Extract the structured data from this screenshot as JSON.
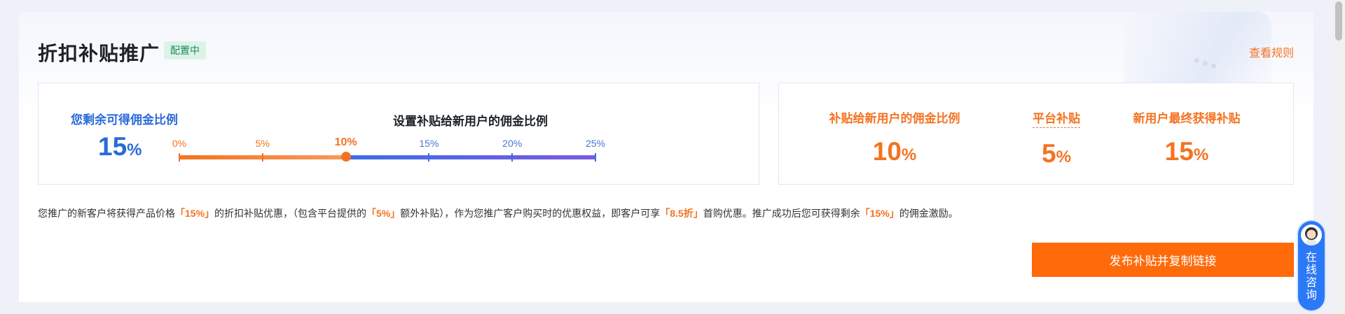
{
  "header": {
    "title": "折扣补贴推广",
    "badge": "配置中",
    "rules_link": "查看规则"
  },
  "commission": {
    "remaining_label": "您剩余可得佣金比例",
    "remaining_value": "15",
    "percent_sign": "%"
  },
  "slider": {
    "title": "设置补贴给新用户的佣金比例",
    "ticks": [
      "0%",
      "5%",
      "10%",
      "15%",
      "20%",
      "25%"
    ],
    "selected_value": 10,
    "max": 25
  },
  "summary": {
    "items": [
      {
        "label": "补贴给新用户的佣金比例",
        "value": "10"
      },
      {
        "label": "平台补贴",
        "value": "5"
      },
      {
        "label": "新用户最终获得补贴",
        "value": "15"
      }
    ]
  },
  "description": {
    "p1": "您推广的新客户将获得产品价格",
    "h1": "「15%」",
    "p2": "的折扣补贴优惠，（包含平台提供的",
    "h2": "「5%」",
    "p3": "额外补贴），作为您推广客户购买时的优惠权益，即客户可享",
    "h3": "「8.5折」",
    "p4": "首购优惠。推广成功后您可获得剩余",
    "h4": "「15%」",
    "p5": "的佣金激励。"
  },
  "actions": {
    "publish_label": "发布补贴并复制链接"
  },
  "floating": {
    "label": "在线咨询"
  },
  "colors": {
    "accent_orange": "#f47321",
    "button_orange": "#ff6a0a",
    "blue": "#2a6ad8",
    "badge_green": "#1a8a55"
  },
  "icons": {
    "avatar": "support-agent-avatar"
  }
}
